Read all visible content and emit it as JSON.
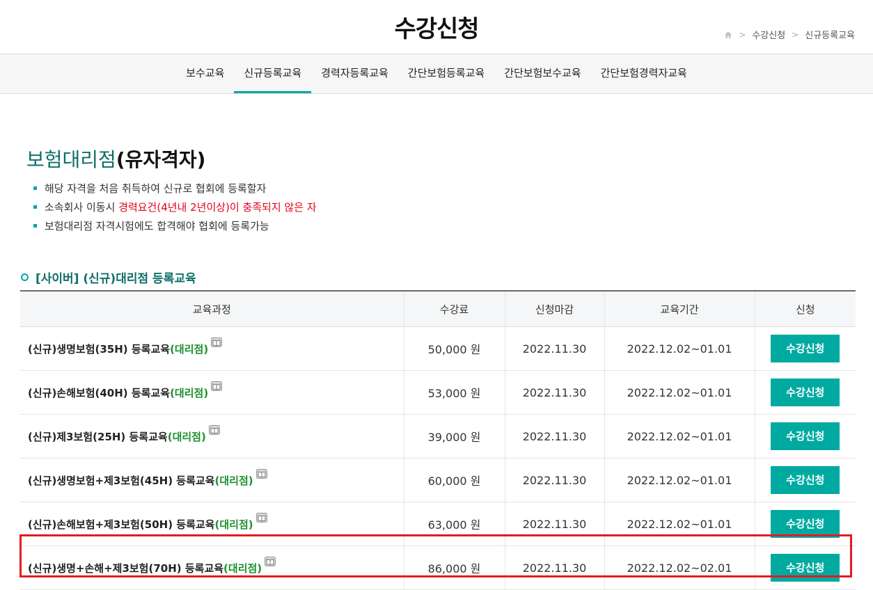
{
  "header": {
    "title": "수강신청",
    "breadcrumb": [
      "수강신청",
      "신규등록교육"
    ]
  },
  "tabs": [
    {
      "label": "보수교육",
      "active": false
    },
    {
      "label": "신규등록교육",
      "active": true
    },
    {
      "label": "경력자등록교육",
      "active": false
    },
    {
      "label": "간단보험등록교육",
      "active": false
    },
    {
      "label": "간단보험보수교육",
      "active": false
    },
    {
      "label": "간단보험경력자교육",
      "active": false
    }
  ],
  "section": {
    "title_highlight": "보험대리점",
    "title_rest": "(유자격자)",
    "bullets": {
      "b1": "해당 자격을 처음 취득하여 신규로 협회에 등록할자",
      "b2_prefix": "소속회사 이동시 ",
      "b2_red": "경력요건(4년내 2년이상)이 충족되지 않은 자",
      "b3": "보험대리점 자격시험에도 합격해야 협회에 등록가능"
    },
    "sub_heading": "[사이버] (신규)대리점 등록교육"
  },
  "table": {
    "headers": [
      "교육과정",
      "수강료",
      "신청마감",
      "교육기간",
      "신청"
    ],
    "rows": [
      {
        "course": "(신규)생명보험(35H) 등록교육",
        "tag": "(대리점)",
        "fee": "50,000 원",
        "deadline": "2022.11.30",
        "period": "2022.12.02~01.01",
        "button": "수강신청"
      },
      {
        "course": "(신규)손해보험(40H) 등록교육",
        "tag": "(대리점)",
        "fee": "53,000 원",
        "deadline": "2022.11.30",
        "period": "2022.12.02~01.01",
        "button": "수강신청"
      },
      {
        "course": "(신규)제3보험(25H) 등록교육",
        "tag": "(대리점)",
        "fee": "39,000 원",
        "deadline": "2022.11.30",
        "period": "2022.12.02~01.01",
        "button": "수강신청"
      },
      {
        "course": "(신규)생명보험+제3보험(45H) 등록교육",
        "tag": "(대리점)",
        "fee": "60,000 원",
        "deadline": "2022.11.30",
        "period": "2022.12.02~01.01",
        "button": "수강신청"
      },
      {
        "course": "(신규)손해보험+제3보험(50H) 등록교육",
        "tag": "(대리점)",
        "fee": "63,000 원",
        "deadline": "2022.11.30",
        "period": "2022.12.02~01.01",
        "button": "수강신청"
      },
      {
        "course": "(신규)생명+손해+제3보험(70H) 등록교육",
        "tag": "(대리점)",
        "fee": "86,000 원",
        "deadline": "2022.11.30",
        "period": "2022.12.02~02.01",
        "button": "수강신청"
      }
    ]
  },
  "colors": {
    "accent": "#00aaa1",
    "highlight_box": "#e31b23",
    "green_tag": "#1c8f2e",
    "warning_red": "#e4001b"
  }
}
